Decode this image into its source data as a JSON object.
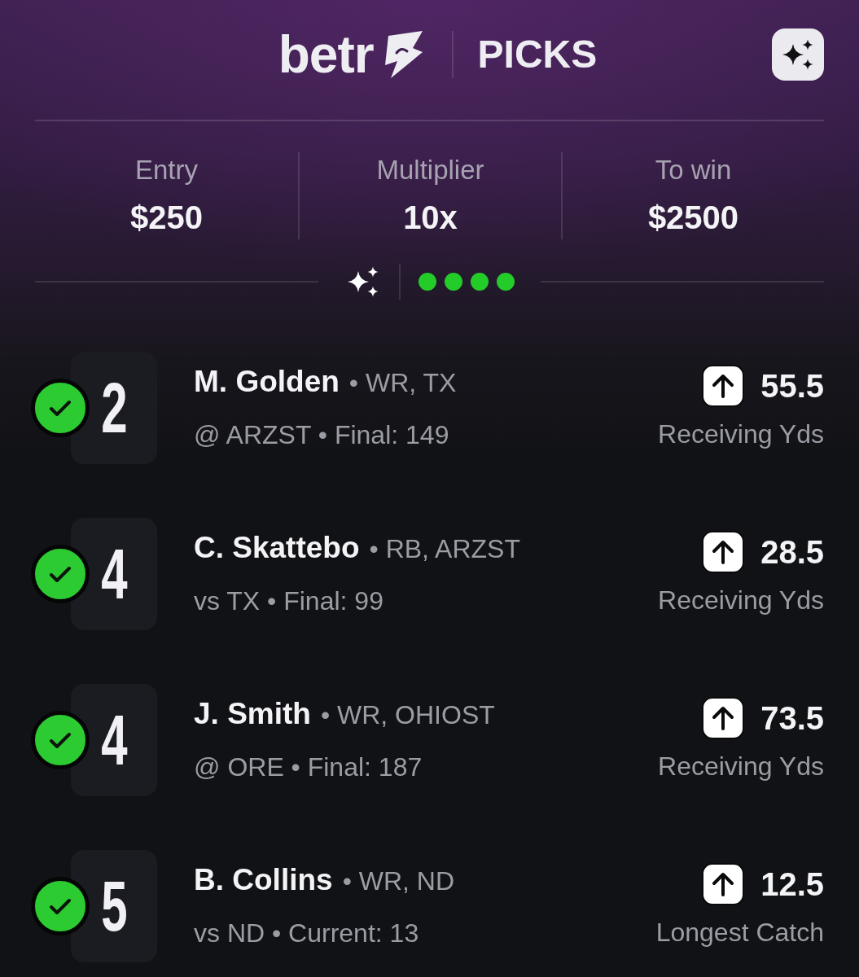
{
  "header": {
    "logo": "betr",
    "title": "PICKS"
  },
  "summary": [
    {
      "label": "Entry",
      "value": "$250"
    },
    {
      "label": "Multiplier",
      "value": "10x"
    },
    {
      "label": "To win",
      "value": "$2500"
    }
  ],
  "status_dots": [
    {
      "won": true
    },
    {
      "won": true
    },
    {
      "won": true
    },
    {
      "won": true
    }
  ],
  "picks": [
    {
      "number": "2",
      "won": true,
      "player": "M. Golden",
      "details": "• WR, TX",
      "game": "@ ARZST • Final: 149",
      "over": true,
      "line": "55.5",
      "stat": "Receiving Yds"
    },
    {
      "number": "4",
      "won": true,
      "player": "C. Skattebo",
      "details": "• RB, ARZST",
      "game": "vs TX • Final: 99",
      "over": true,
      "line": "28.5",
      "stat": "Receiving Yds"
    },
    {
      "number": "4",
      "won": true,
      "player": "J. Smith",
      "details": "• WR, OHIOST",
      "game": "@ ORE • Final: 187",
      "over": true,
      "line": "73.5",
      "stat": "Receiving Yds"
    },
    {
      "number": "5",
      "won": true,
      "player": "B. Collins",
      "details": "• WR, ND",
      "game": "vs ND • Current: 13",
      "over": true,
      "line": "12.5",
      "stat": "Longest Catch"
    }
  ]
}
